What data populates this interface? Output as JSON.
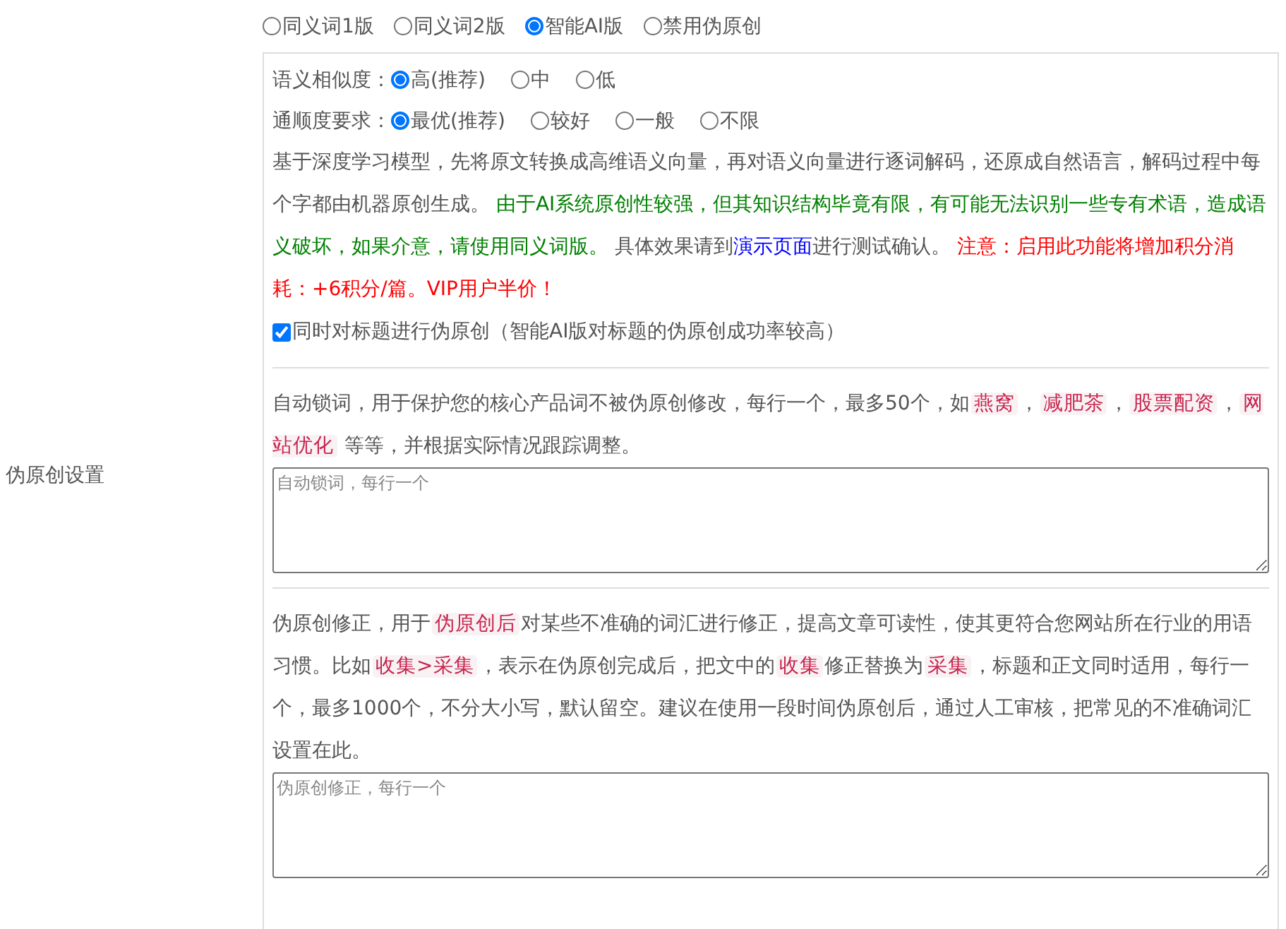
{
  "section_label": "伪原创设置",
  "modes": [
    {
      "label": "同义词1版",
      "selected": false
    },
    {
      "label": "同义词2版",
      "selected": false
    },
    {
      "label": "智能AI版",
      "selected": true
    },
    {
      "label": "禁用伪原创",
      "selected": false
    }
  ],
  "similarity": {
    "label": "语义相似度：",
    "options": [
      {
        "label": "高(推荐)",
        "selected": true
      },
      {
        "label": "中",
        "selected": false
      },
      {
        "label": "低",
        "selected": false
      }
    ]
  },
  "fluency": {
    "label": "通顺度要求：",
    "options": [
      {
        "label": "最优(推荐)",
        "selected": true
      },
      {
        "label": "较好",
        "selected": false
      },
      {
        "label": "一般",
        "selected": false
      },
      {
        "label": "不限",
        "selected": false
      }
    ]
  },
  "ai_description": [
    {
      "kind": "plain",
      "text": "基于深度学习模型，先将原文转换成高维语义向量，再对语义向量进行逐词解码，还原成自然语言，解码过程中每个字都由机器原创生成。 "
    },
    {
      "kind": "note",
      "text": "由于AI系统原创性较强，但其知识结构毕竟有限，有可能无法识别一些专有术语，造成语义破坏，如果介意，请使用同义词版。"
    },
    {
      "kind": "plain",
      "text": " 具体效果请到"
    },
    {
      "kind": "link",
      "text": "演示页面"
    },
    {
      "kind": "plain",
      "text": "进行测试确认。 "
    },
    {
      "kind": "warning",
      "text": "注意：启用此功能将增加积分消耗：+6积分/篇。VIP用户半价！"
    }
  ],
  "title_rewrite": {
    "label": "同时对标题进行伪原创（智能AI版对标题的伪原创成功率较高）",
    "checked": true
  },
  "lock_words": {
    "description": [
      {
        "kind": "plain",
        "text": "自动锁词，用于保护您的核心产品词不被伪原创修改，每行一个，最多50个，如"
      },
      {
        "kind": "code",
        "text": "燕窝"
      },
      {
        "kind": "plain",
        "text": "，"
      },
      {
        "kind": "code",
        "text": "减肥茶"
      },
      {
        "kind": "plain",
        "text": "，"
      },
      {
        "kind": "code",
        "text": "股票配资"
      },
      {
        "kind": "plain",
        "text": "，"
      },
      {
        "kind": "code",
        "text": "网站优化"
      },
      {
        "kind": "plain",
        "text": " 等等，并根据实际情况跟踪调整。"
      }
    ],
    "placeholder": "自动锁词，每行一个"
  },
  "corrections": {
    "description": [
      {
        "kind": "plain",
        "text": "伪原创修正，用于"
      },
      {
        "kind": "code",
        "text": "伪原创后"
      },
      {
        "kind": "plain",
        "text": "对某些不准确的词汇进行修正，提高文章可读性，使其更符合您网站所在行业的用语习惯。比如"
      },
      {
        "kind": "code",
        "text": "收集>采集"
      },
      {
        "kind": "plain",
        "text": "，表示在伪原创完成后，把文中的"
      },
      {
        "kind": "code",
        "text": "收集"
      },
      {
        "kind": "plain",
        "text": "修正替换为"
      },
      {
        "kind": "code",
        "text": "采集"
      },
      {
        "kind": "plain",
        "text": "，标题和正文同时适用，每行一个，最多1000个，不分大小写，默认留空。建议在使用一段时间伪原创后，通过人工审核，把常见的不准确词汇设置在此。"
      }
    ],
    "placeholder": "伪原创修正，每行一个"
  }
}
